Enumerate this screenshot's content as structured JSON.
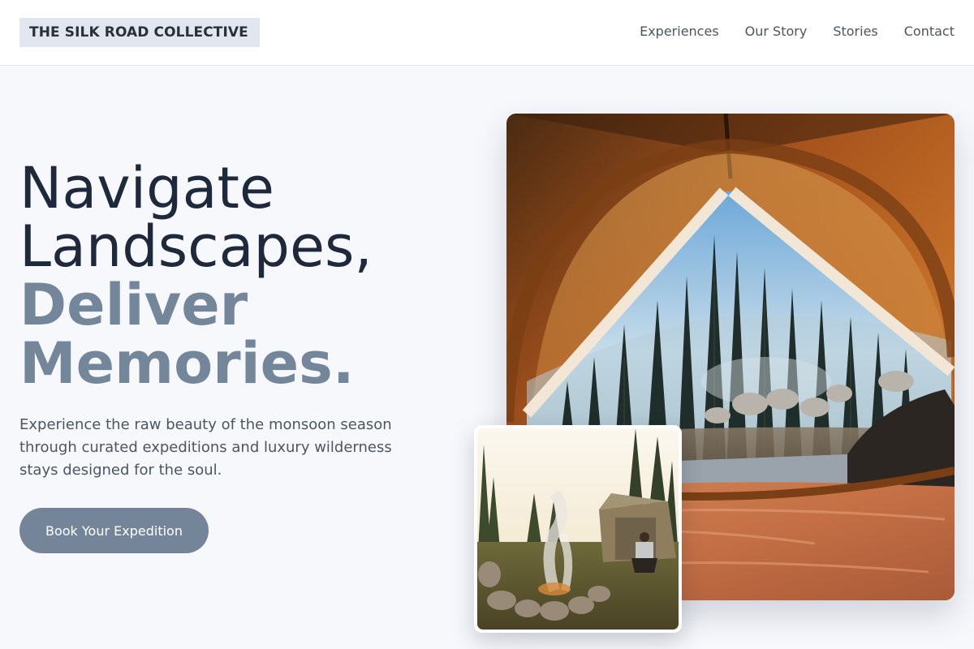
{
  "header": {
    "brand": "THE SILK ROAD COLLECTIVE",
    "nav": [
      {
        "label": "Experiences"
      },
      {
        "label": "Our Story"
      },
      {
        "label": "Stories"
      },
      {
        "label": "Contact"
      }
    ]
  },
  "hero": {
    "headline": {
      "line1": "Navigate",
      "line2": "Landscapes,",
      "line3": "Deliver",
      "line4": "Memories."
    },
    "lead": "Experience the raw beauty of the monsoon season through curated expeditions and luxury wilderness stays designed for the soul.",
    "cta_label": "Book Your Expedition"
  },
  "images": {
    "main": "tent-interior-forest-view",
    "inset": "campfire-camper-forest"
  },
  "colors": {
    "background": "#f7f8fc",
    "heading": "#1e293b",
    "accent": "#748599",
    "logo_bg": "#e2e7ef"
  }
}
